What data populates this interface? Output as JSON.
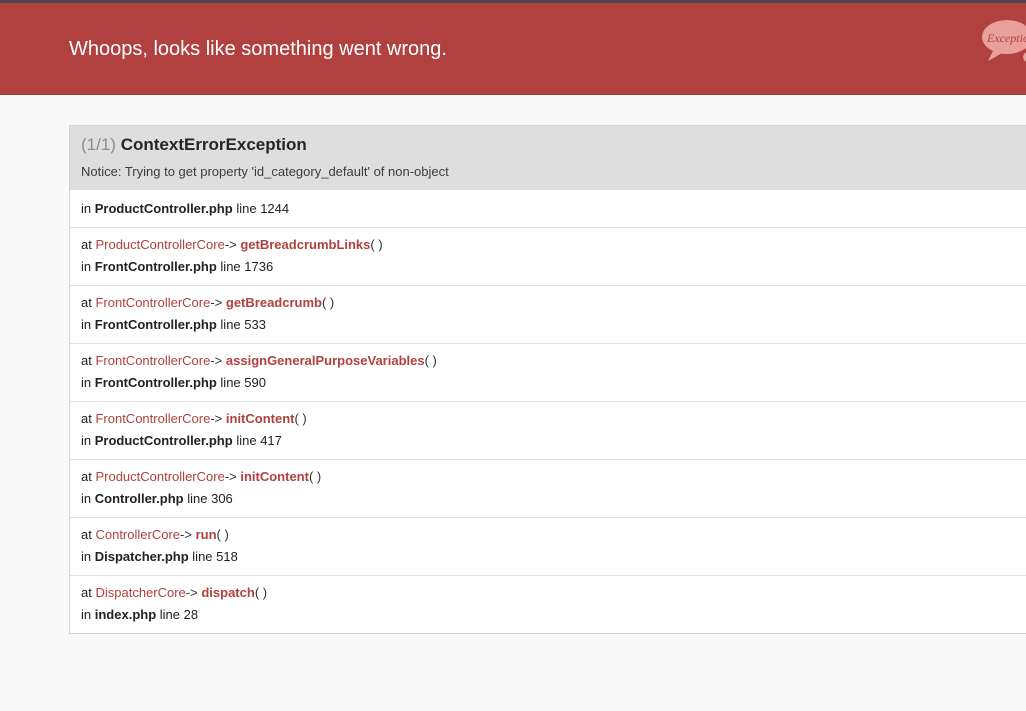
{
  "header": {
    "title": "Whoops, looks like something went wrong.",
    "logo_text": "Exception"
  },
  "exception": {
    "count": "(1/1)",
    "name": "ContextErrorException",
    "message": "Notice: Trying to get property 'id_category_default' of non-object"
  },
  "labels": {
    "in": "in",
    "at": "at",
    "arrow": "->",
    "line": "line",
    "parens": "( )"
  },
  "origin": {
    "file": "ProductController.php",
    "line": "1244"
  },
  "trace": [
    {
      "class": "ProductControllerCore",
      "method": "getBreadcrumbLinks",
      "file": "FrontController.php",
      "line": "1736"
    },
    {
      "class": "FrontControllerCore",
      "method": "getBreadcrumb",
      "file": "FrontController.php",
      "line": "533"
    },
    {
      "class": "FrontControllerCore",
      "method": "assignGeneralPurposeVariables",
      "file": "FrontController.php",
      "line": "590"
    },
    {
      "class": "FrontControllerCore",
      "method": "initContent",
      "file": "ProductController.php",
      "line": "417"
    },
    {
      "class": "ProductControllerCore",
      "method": "initContent",
      "file": "Controller.php",
      "line": "306"
    },
    {
      "class": "ControllerCore",
      "method": "run",
      "file": "Dispatcher.php",
      "line": "518"
    },
    {
      "class": "DispatcherCore",
      "method": "dispatch",
      "file": "index.php",
      "line": "28"
    }
  ],
  "colors": {
    "header_bg": "#b0413e",
    "accent": "#b0413e",
    "logo_bubble": "#e9a09c"
  },
  "icons": {
    "logo": "exception-speech-bubble-logo"
  }
}
